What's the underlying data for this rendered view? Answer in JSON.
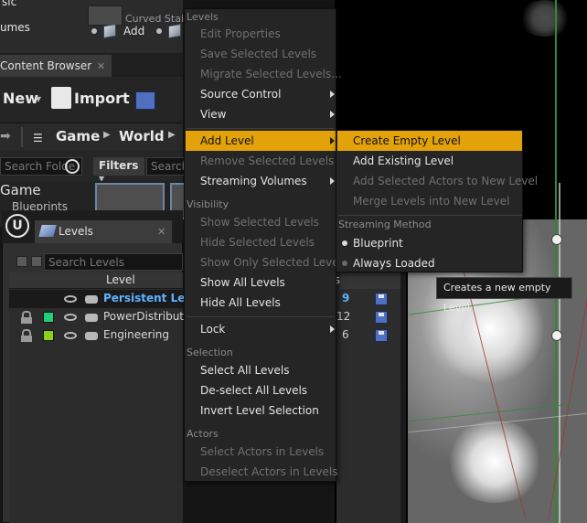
{
  "top_panel": {
    "sic_label": "sic",
    "umes_label": "umes",
    "add_label": "Add",
    "curved_label": "Curved Stai"
  },
  "content_browser": {
    "tab_label": "Content Browser",
    "new_label": "New",
    "import_label": "Import",
    "path": [
      "Game",
      "World"
    ],
    "search_folders_placeholder": "Search Folde",
    "filters_label": "Filters",
    "search_assets_placeholder": "Search",
    "tree_game": "Game",
    "tree_blueprints": "Blueprints"
  },
  "levels_panel": {
    "tab_label": "Levels",
    "search_placeholder": "Search Levels",
    "column_level": "Level",
    "column_actors": "Actors",
    "rows": [
      {
        "name": "Persistent Level",
        "actors": "9",
        "color": "",
        "selected": true
      },
      {
        "name": "PowerDistribution",
        "actors": "12",
        "color": "#1fcf7a",
        "selected": false
      },
      {
        "name": "Engineering",
        "actors": "6",
        "color": "#8ad21a",
        "selected": false
      }
    ]
  },
  "main_menu": {
    "sections": {
      "levels": "Levels",
      "visibility": "Visibility",
      "selection": "Selection",
      "actors": "Actors"
    },
    "items": {
      "edit_properties": "Edit Properties",
      "save_selected_levels": "Save Selected Levels",
      "migrate_selected_levels": "Migrate Selected Levels...",
      "source_control": "Source Control",
      "view": "View",
      "add_level": "Add Level",
      "remove_selected_levels": "Remove Selected Levels",
      "streaming_volumes": "Streaming Volumes",
      "show_selected_levels": "Show Selected Levels",
      "hide_selected_levels": "Hide Selected Levels",
      "show_only_selected_levels": "Show Only Selected Levels",
      "show_all_levels": "Show All Levels",
      "hide_all_levels": "Hide All Levels",
      "lock": "Lock",
      "select_all_levels": "Select All Levels",
      "deselect_all_levels": "De-select All Levels",
      "invert_level_selection": "Invert Level Selection",
      "select_actors_in_levels": "Select Actors in Levels",
      "deselect_actors_in_levels": "Deselect Actors in Levels"
    }
  },
  "submenu": {
    "create_empty_level": "Create Empty Level",
    "add_existing_level": "Add Existing Level",
    "add_selected_actors_to_new_level": "Add Selected Actors to New Level",
    "merge_levels_into_new_level": "Merge Levels into New Level",
    "streaming_method_section": "Streaming Method",
    "blueprint": "Blueprint",
    "always_loaded": "Always Loaded"
  },
  "tooltip": "Creates a new empty Level",
  "colors": {
    "highlight": "#e3a20a",
    "selected_level_text": "#5fb3ff",
    "menu_bg": "#252525"
  }
}
